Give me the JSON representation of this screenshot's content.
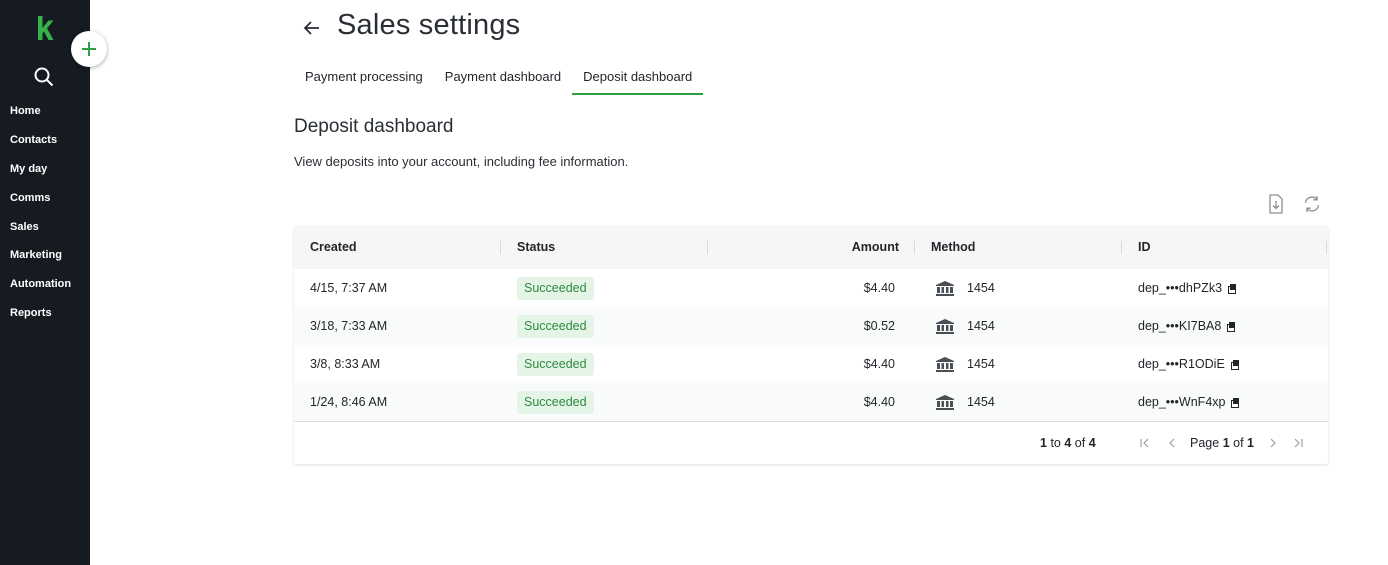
{
  "colors": {
    "sidebar_bg": "#161b22",
    "accent_green": "#2f9e44",
    "badge_bg": "#e4f5e8",
    "badge_text": "#2e8a3e"
  },
  "sidebar": {
    "logo": "keap-logo-icon",
    "items": [
      "Home",
      "Contacts",
      "My day",
      "Comms",
      "Sales",
      "Marketing",
      "Automation",
      "Reports"
    ]
  },
  "header": {
    "title": "Sales settings"
  },
  "tabs": [
    {
      "label": "Payment processing",
      "active": false
    },
    {
      "label": "Payment dashboard",
      "active": false
    },
    {
      "label": "Deposit dashboard",
      "active": true
    }
  ],
  "section": {
    "title": "Deposit dashboard",
    "description": "View deposits into your account, including fee information."
  },
  "table": {
    "columns": [
      "Created",
      "Status",
      "Amount",
      "Method",
      "ID"
    ],
    "rows": [
      {
        "created": "4/15, 7:37 AM",
        "status": "Succeeded",
        "amount": "$4.40",
        "method": "1454",
        "id": "dep_•••dhPZk3"
      },
      {
        "created": "3/18, 7:33 AM",
        "status": "Succeeded",
        "amount": "$0.52",
        "method": "1454",
        "id": "dep_•••KI7BA8"
      },
      {
        "created": "3/8, 8:33 AM",
        "status": "Succeeded",
        "amount": "$4.40",
        "method": "1454",
        "id": "dep_•••R1ODiE"
      },
      {
        "created": "1/24, 8:46 AM",
        "status": "Succeeded",
        "amount": "$4.40",
        "method": "1454",
        "id": "dep_•••WnF4xp"
      }
    ]
  },
  "pagination": {
    "range_start": "1",
    "to": "to",
    "range_end": "4",
    "of": "of",
    "total": "4",
    "page_label": "Page",
    "page": "1",
    "page_of": "of",
    "pages": "1"
  }
}
